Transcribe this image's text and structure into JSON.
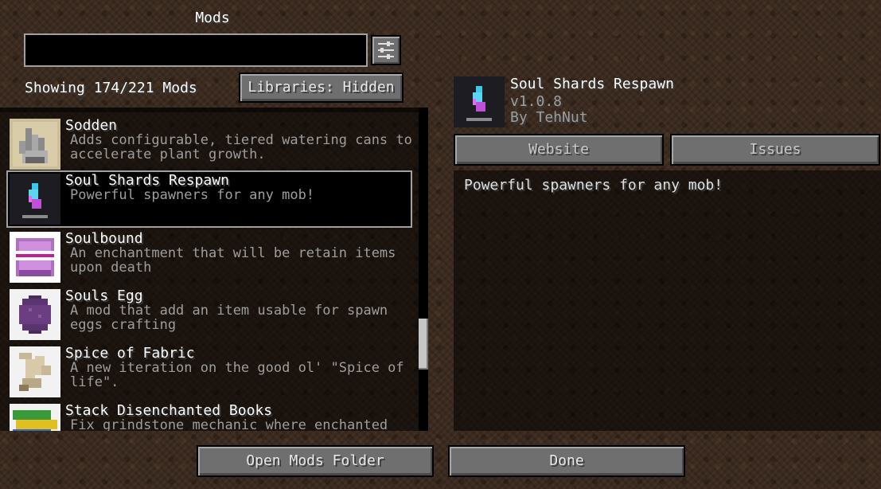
{
  "header": {
    "title": "Mods"
  },
  "search": {
    "value": "",
    "placeholder": ""
  },
  "filter": {
    "icon": "sliders-icon"
  },
  "status": {
    "showing": "Showing 174/221 Mods"
  },
  "libraries_button": {
    "label": "Libraries: Hidden"
  },
  "mod_list": {
    "items": [
      {
        "name": "Sodden",
        "description": "Adds configurable, tiered watering cans to accelerate plant growth.",
        "icon": "watering-can-icon"
      },
      {
        "name": "Soul Shards Respawn",
        "description": "Powerful spawners for any mob!",
        "icon": "soul-shard-icon"
      },
      {
        "name": "Soulbound",
        "description": "An enchantment that will be retain items upon death",
        "icon": "soulbound-book-icon"
      },
      {
        "name": "Souls Egg",
        "description": "A mod that add an item usable for spawn eggs crafting",
        "icon": "spawn-egg-icon"
      },
      {
        "name": "Spice of Fabric",
        "description": "A new iteration on the good ol' \"Spice of life\".",
        "icon": "scroll-icon"
      },
      {
        "name": "Stack Disenchanted Books",
        "description": "Fix grindstone mechanic where enchanted",
        "icon": "books-icon"
      }
    ],
    "selected_index": 1
  },
  "detail": {
    "name": "Soul Shards Respawn",
    "version": "v1.0.8",
    "author": "By TehNut",
    "website_label": "Website",
    "issues_label": "Issues",
    "description": "Powerful spawners for any mob!",
    "icon": "soul-shard-icon"
  },
  "footer": {
    "open_folder_label": "Open Mods Folder",
    "done_label": "Done"
  }
}
